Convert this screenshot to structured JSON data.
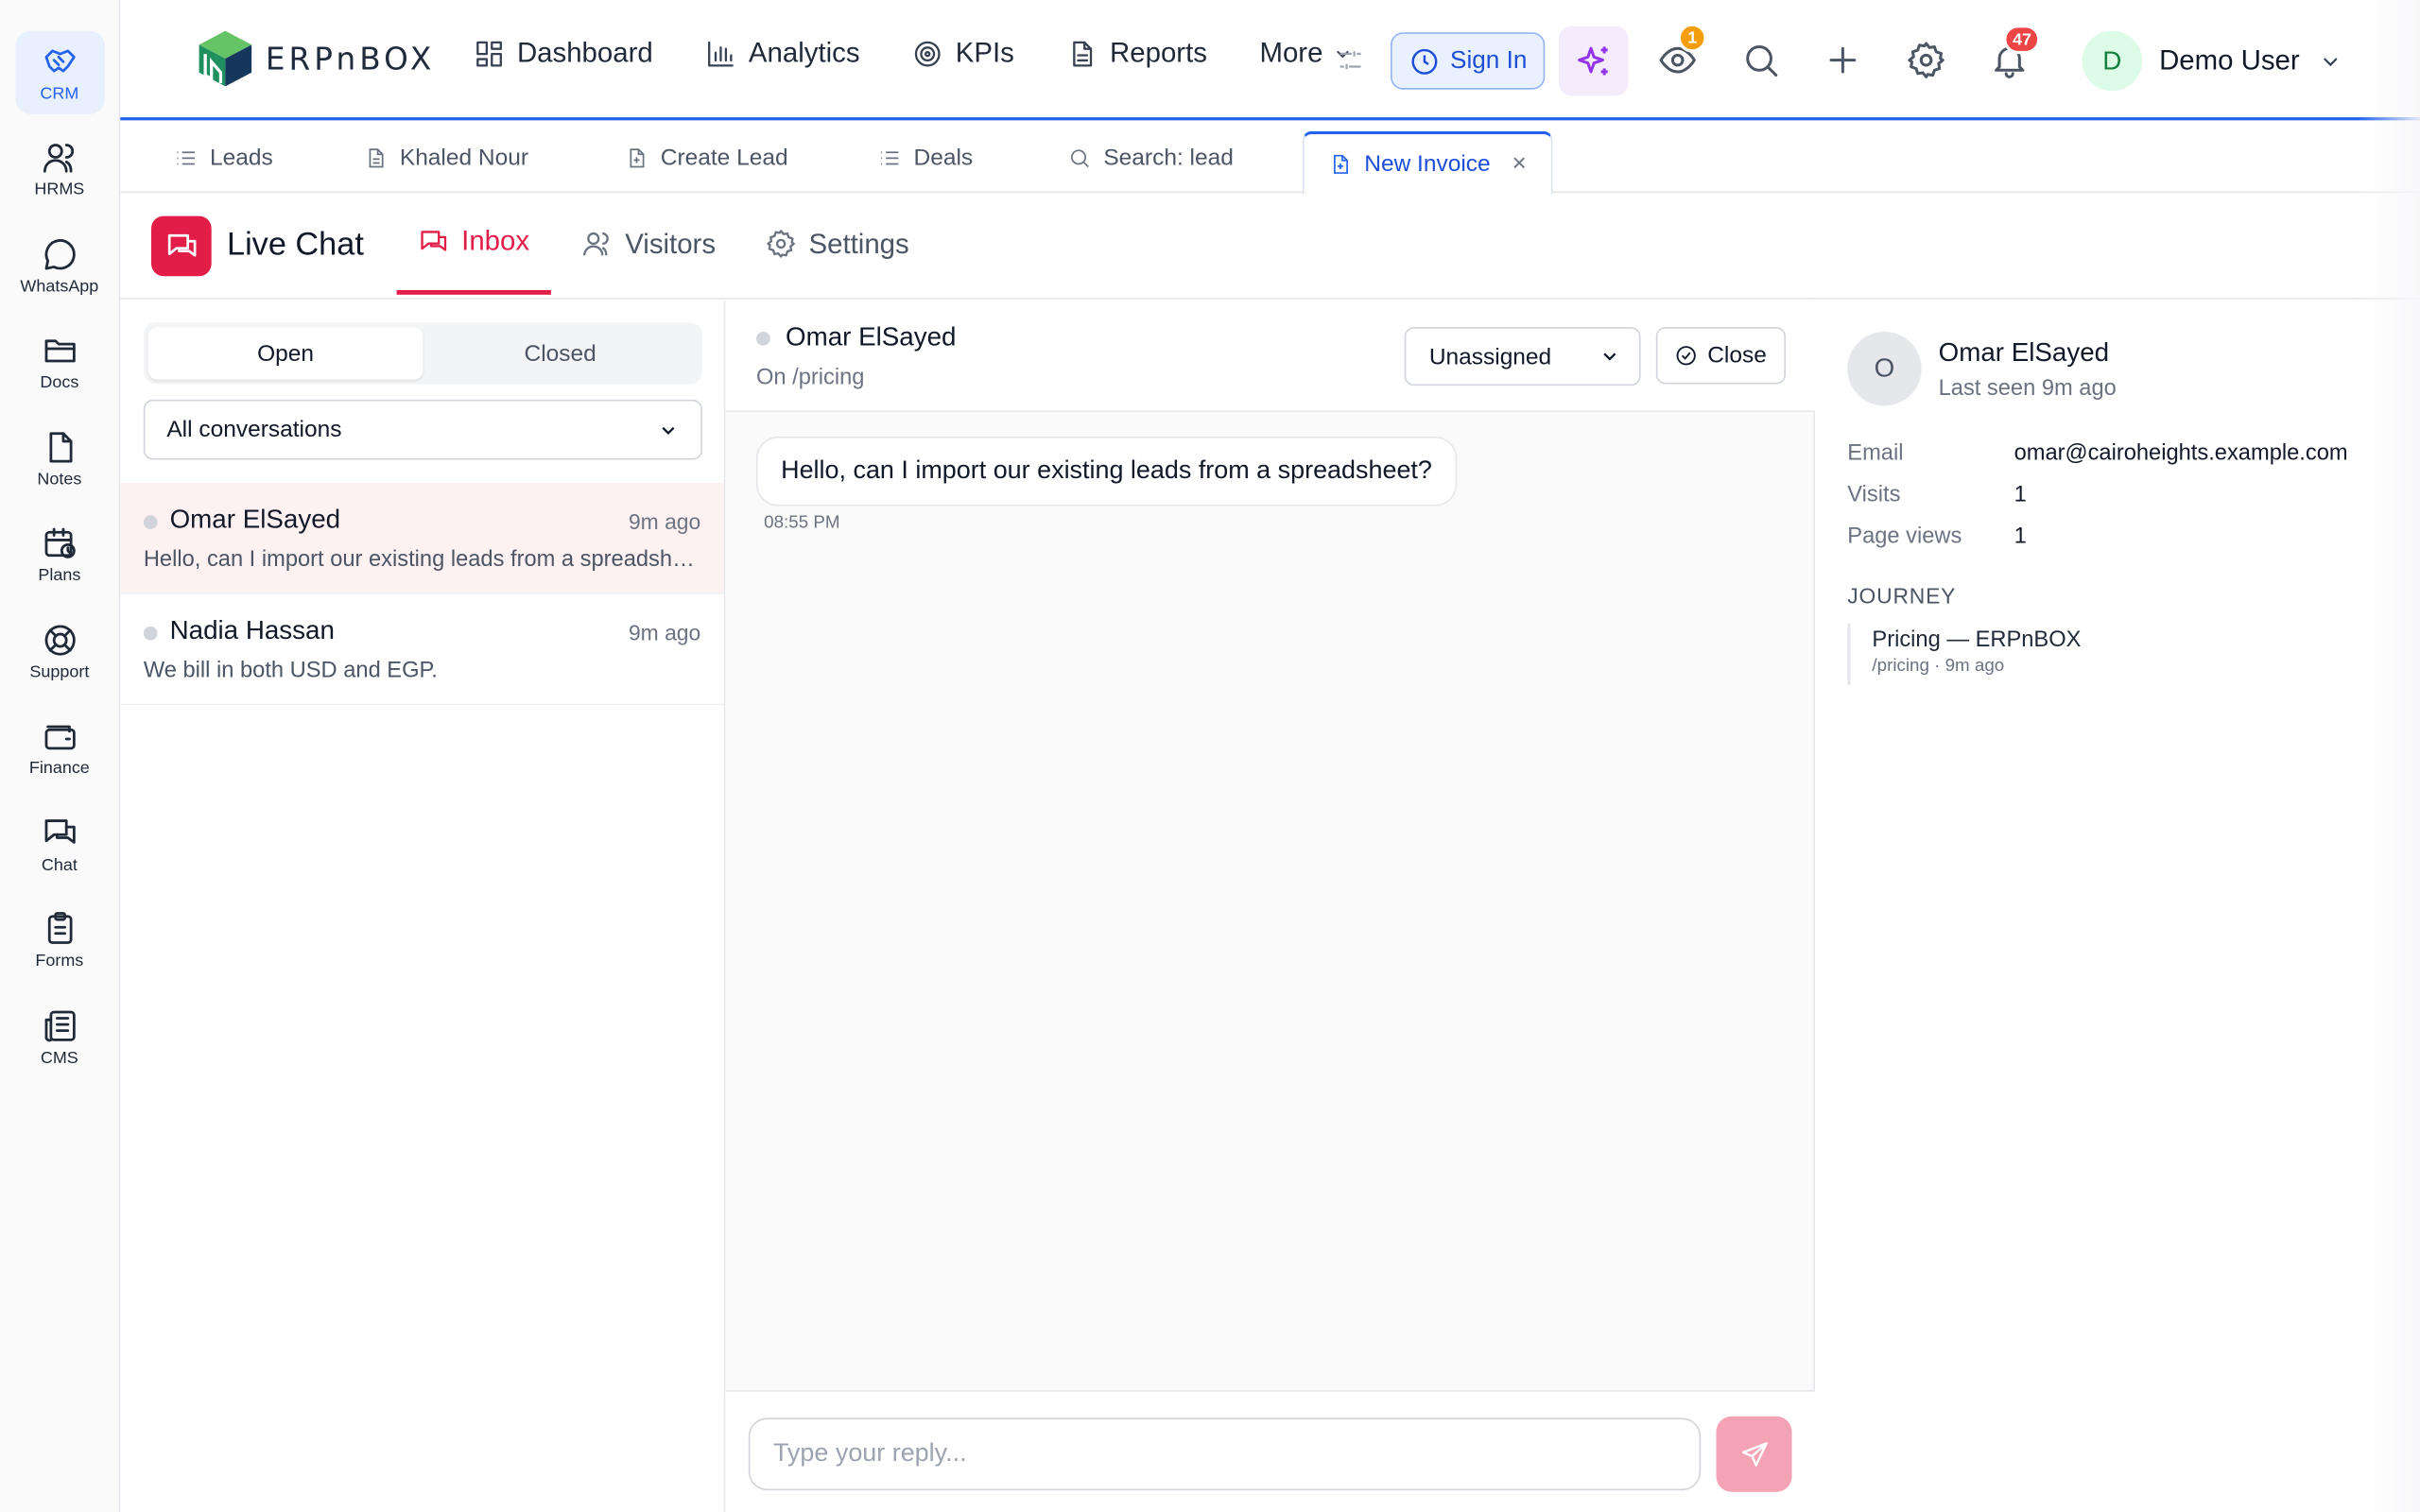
{
  "rail": [
    {
      "label": "CRM",
      "icon": "handshake-icon",
      "active": true
    },
    {
      "label": "HRMS",
      "icon": "users-icon"
    },
    {
      "label": "WhatsApp",
      "icon": "message-circle-icon"
    },
    {
      "label": "Docs",
      "icon": "folder-icon"
    },
    {
      "label": "Notes",
      "icon": "file-icon"
    },
    {
      "label": "Plans",
      "icon": "calendar-clock-icon"
    },
    {
      "label": "Support",
      "icon": "lifebuoy-icon"
    },
    {
      "label": "Finance",
      "icon": "wallet-icon"
    },
    {
      "label": "Chat",
      "icon": "messages-icon"
    },
    {
      "label": "Forms",
      "icon": "clipboard-icon"
    },
    {
      "label": "CMS",
      "icon": "newspaper-icon"
    }
  ],
  "brand": {
    "logo_text": "ERPnBOX"
  },
  "nav": {
    "dashboard": "Dashboard",
    "analytics": "Analytics",
    "kpis": "KPIs",
    "reports": "Reports",
    "more": "More"
  },
  "header": {
    "sign_in": "Sign In",
    "watch_badge": "1",
    "notif_badge": "47",
    "user_initial": "D",
    "user_name": "Demo User"
  },
  "window_tabs": {
    "leads": "Leads",
    "khaled": "Khaled Nour",
    "create_lead": "Create Lead",
    "deals": "Deals",
    "search": "Search: lead",
    "new_invoice": "New Invoice",
    "close_glyph": "×"
  },
  "module": {
    "title": "Live Chat",
    "tabs": {
      "inbox": "Inbox",
      "visitors": "Visitors",
      "settings": "Settings"
    }
  },
  "conversations": {
    "segments": {
      "open": "Open",
      "closed": "Closed"
    },
    "filter": "All conversations",
    "items": [
      {
        "name": "Omar ElSayed",
        "time": "9m ago",
        "preview": "Hello, can I import our existing leads from a spreadsheet?"
      },
      {
        "name": "Nadia Hassan",
        "time": "9m ago",
        "preview": "We bill in both USD and EGP."
      }
    ]
  },
  "chat": {
    "name": "Omar ElSayed",
    "location": "On /pricing",
    "assignee": "Unassigned",
    "close_label": "Close",
    "messages": [
      {
        "text": "Hello, can I import our existing leads from a spreadsheet?",
        "time": "08:55 PM"
      }
    ],
    "reply_placeholder": "Type your reply..."
  },
  "visitor": {
    "initial": "O",
    "name": "Omar ElSayed",
    "last_seen": "Last seen 9m ago",
    "fields": {
      "email_label": "Email",
      "email": "omar@cairoheights.example.com",
      "visits_label": "Visits",
      "visits": "1",
      "pageviews_label": "Page views",
      "pageviews": "1"
    },
    "journey_heading": "JOURNEY",
    "journey": [
      {
        "title": "Pricing — ERPnBOX",
        "meta": "/pricing · 9m ago"
      }
    ]
  },
  "colors": {
    "accent": "#2563eb",
    "brand_red": "#e11d48",
    "ai_purple": "#9333ea",
    "badge_orange": "#f59e0b",
    "badge_red": "#ef4444"
  }
}
